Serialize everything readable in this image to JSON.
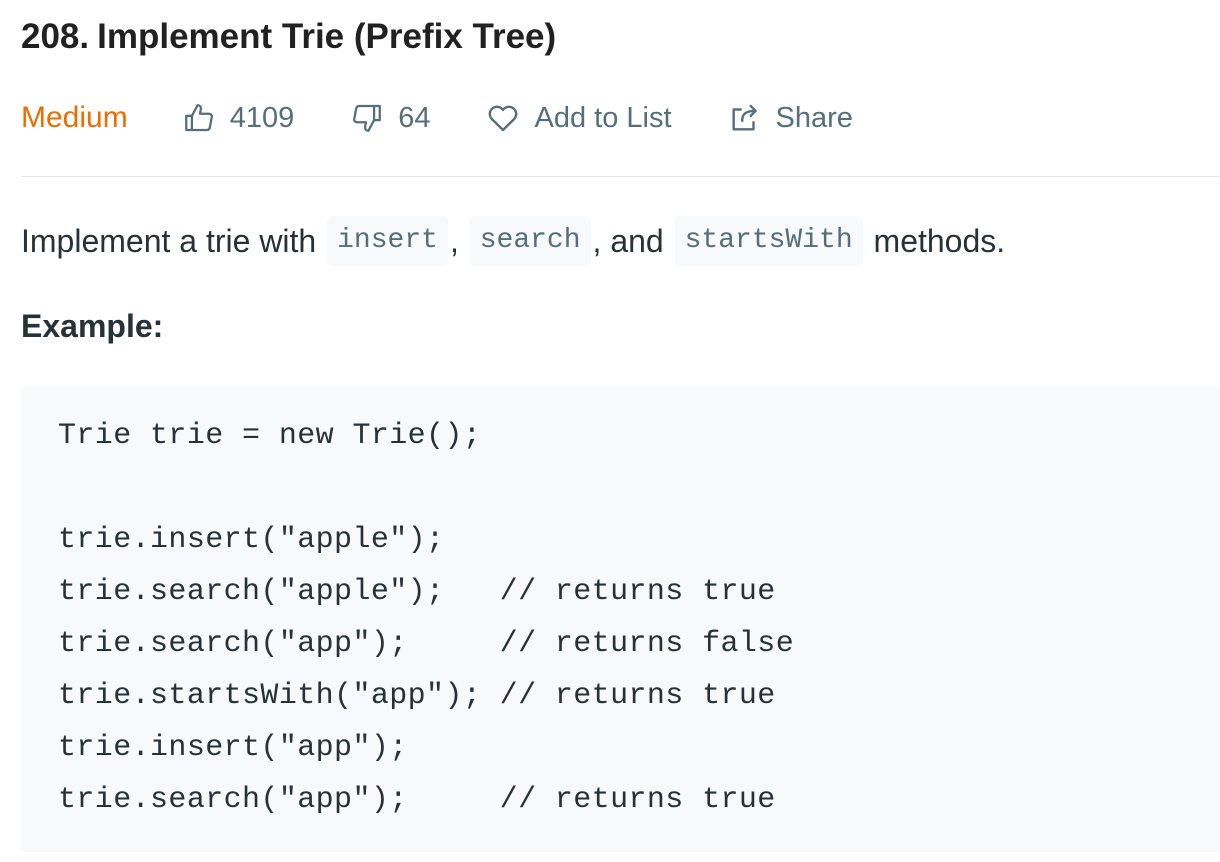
{
  "problem": {
    "number": "208.",
    "title": "Implement Trie (Prefix Tree)"
  },
  "meta": {
    "difficulty": "Medium",
    "difficulty_color": "#ef6c00",
    "likes": "4109",
    "dislikes": "64",
    "add_to_list": "Add to List",
    "share": "Share",
    "icons": {
      "likes": "thumbs-up-icon",
      "dislikes": "thumbs-down-icon",
      "add_to_list": "heart-icon",
      "share": "share-icon"
    }
  },
  "description": {
    "part1": "Implement a trie with ",
    "code1": "insert",
    "part2": ", ",
    "code2": "search",
    "part3": ", and ",
    "code3": "startsWith",
    "part4": " methods."
  },
  "example": {
    "heading": "Example:",
    "code_lines": [
      "Trie trie = new Trie();",
      "",
      "trie.insert(\"apple\");",
      "trie.search(\"apple\");   // returns true",
      "trie.search(\"app\");     // returns false",
      "trie.startsWith(\"app\"); // returns true",
      "trie.insert(\"app\");",
      "trie.search(\"app\");     // returns true"
    ]
  }
}
